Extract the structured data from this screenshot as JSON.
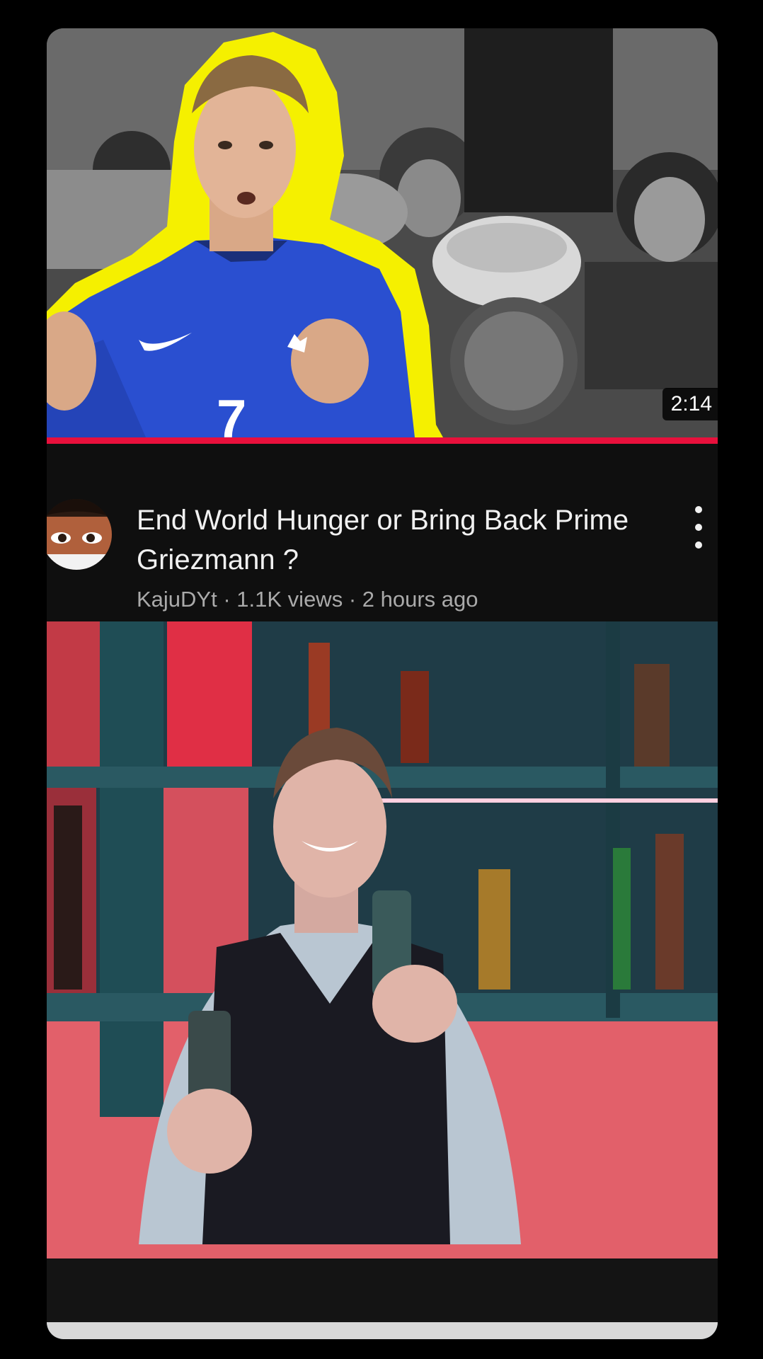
{
  "video": {
    "title": "End World Hunger or Bring Back Prime Griezmann ?",
    "channel": "KajuDYt",
    "views": "1.1K views",
    "age": "2 hours ago",
    "separator": " · ",
    "duration": "2:14",
    "progress": 1.0,
    "jersey_number": "7"
  },
  "icons": {
    "more": "more-vert-icon",
    "avatar": "channel-avatar"
  },
  "colors": {
    "background": "#000000",
    "card": "#0f0f0f",
    "progress": "#e8103c",
    "title": "#f1f1f1",
    "meta": "#aaaaaa",
    "outline": "#f5f000",
    "jersey": "#2a4fd0"
  }
}
